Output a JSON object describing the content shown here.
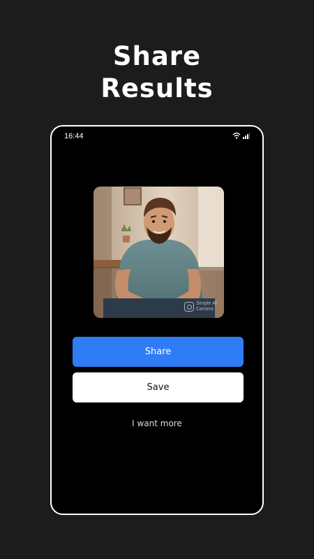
{
  "headline": {
    "line1": "Share",
    "line2": "Results"
  },
  "status_bar": {
    "time": "16:44",
    "icons": [
      "wifi-icon",
      "signal-icon"
    ]
  },
  "result_image": {
    "watermark_line1": "Simple AI",
    "watermark_line2": "Camera",
    "watermark_icon": "instagram-icon"
  },
  "actions": {
    "share_label": "Share",
    "save_label": "Save",
    "more_label": "I want more"
  },
  "colors": {
    "background": "#1c1c1c",
    "phone_screen": "#000000",
    "share_button": "#2f7cf6",
    "save_button": "#ffffff"
  }
}
